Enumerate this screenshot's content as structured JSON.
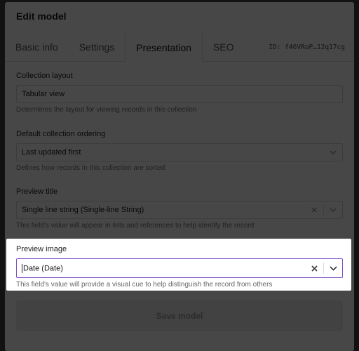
{
  "modal": {
    "title": "Edit model",
    "tabs": [
      {
        "label": "Basic info"
      },
      {
        "label": "Settings"
      },
      {
        "label": "Presentation"
      },
      {
        "label": "SEO"
      }
    ],
    "model_id": "ID: f46VRoP…12q17cg"
  },
  "fields": {
    "collection_layout": {
      "label": "Collection layout",
      "value": "Tabular view",
      "hint": "Determines the layout for viewing records in this collection"
    },
    "default_ordering": {
      "label": "Default collection ordering",
      "value": "Last updated first",
      "hint": "Defines how records in this collection are sorted"
    },
    "preview_title": {
      "label": "Preview title",
      "value": "Single line string (Single-line String)",
      "hint": "This field's value will appear in lists and references to help identify the record"
    },
    "preview_image": {
      "label": "Preview image",
      "value": "Date (Date)",
      "hint": "This field's value will provide a visual cue to help distinguish the record from others"
    }
  },
  "actions": {
    "save_label": "Save model"
  },
  "colors": {
    "focus_border": "#7b4fc8",
    "overlay": "#404040"
  }
}
